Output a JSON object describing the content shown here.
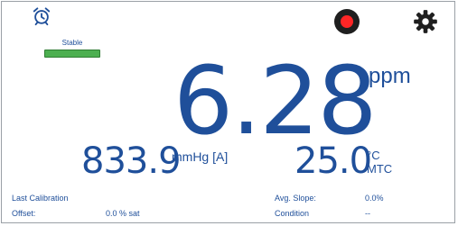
{
  "status": {
    "stable_label": "Stable",
    "colors": {
      "accent": "#1f4f9a",
      "stable": "#4caf50",
      "record": "#ff2626"
    }
  },
  "icons": {
    "alarm": "alarm-clock-icon",
    "record": "record-icon",
    "settings": "gear-icon"
  },
  "main": {
    "value": "6.28",
    "unit": "ppm"
  },
  "pressure": {
    "value": "833.9",
    "unit": "mmHg [A]"
  },
  "temperature": {
    "value": "25.0",
    "unit": "°C",
    "mode": "MTC"
  },
  "info": {
    "last_calibration_label": "Last Calibration",
    "offset_label": "Offset:",
    "offset_value": "0.0 % sat",
    "avg_slope_label": "Avg. Slope:",
    "avg_slope_value": "0.0%",
    "condition_label": "Condition",
    "condition_value": "--"
  }
}
